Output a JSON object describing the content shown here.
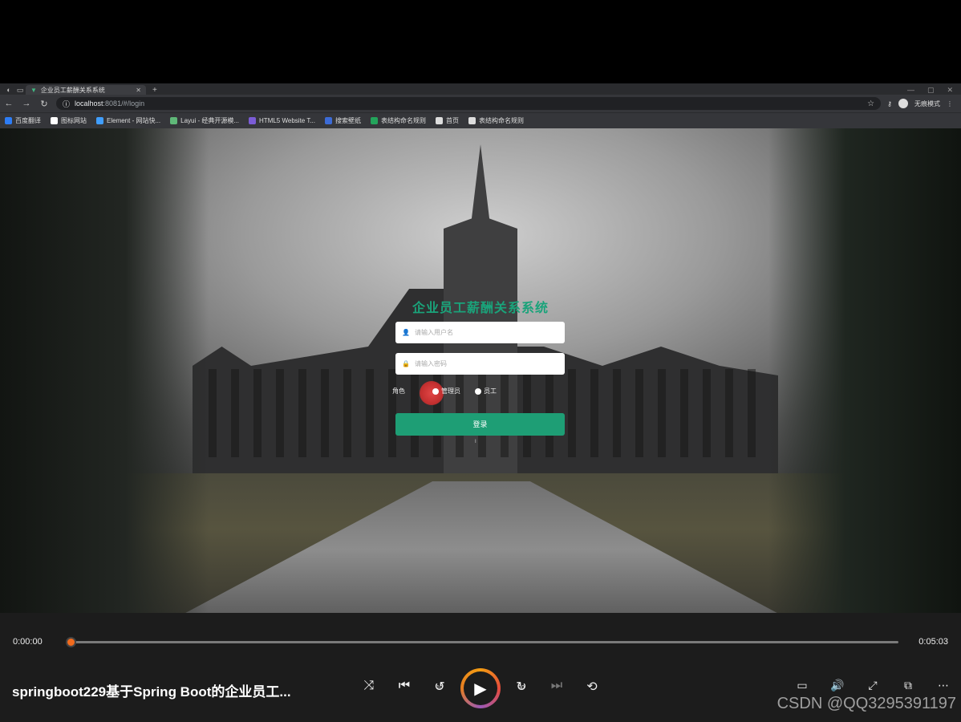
{
  "browser": {
    "tab_title": "企业员工薪酬关系系统",
    "url_host": "localhost",
    "url_path": ":8081/#/login",
    "profile_label": "无痕模式",
    "bookmarks": [
      {
        "label": "百度翻译",
        "color": "#2d7df6"
      },
      {
        "label": "图标网站",
        "color": "#ffffff"
      },
      {
        "label": "Element - 网站快...",
        "color": "#409eff"
      },
      {
        "label": "Layui - 经典开源模...",
        "color": "#5fb878"
      },
      {
        "label": "HTML5 Website T...",
        "color": "#7b5cd6"
      },
      {
        "label": "搜索壁纸",
        "color": "#3c6bd6"
      },
      {
        "label": "表结构命名规则",
        "color": "#23a45b"
      },
      {
        "label": "首页",
        "color": "#dddddd"
      },
      {
        "label": "表结构命名规则",
        "color": "#dddddd"
      }
    ]
  },
  "login": {
    "title": "企业员工薪酬关系系统",
    "username_placeholder": "请输入用户名",
    "password_placeholder": "请输入密码",
    "role_label": "角色",
    "roles": [
      "管理员",
      "员工"
    ],
    "submit_label": "登录",
    "accent_color": "#1e9e75"
  },
  "player": {
    "current_time": "0:00:00",
    "total_time": "0:05:03",
    "progress": 0.0,
    "video_title": "springboot229基于Spring Boot的企业员工...",
    "skip_back_seconds": "10",
    "skip_forward_seconds": "30",
    "accent_color": "#f26b1d"
  },
  "watermark": "CSDN @QQ3295391197"
}
